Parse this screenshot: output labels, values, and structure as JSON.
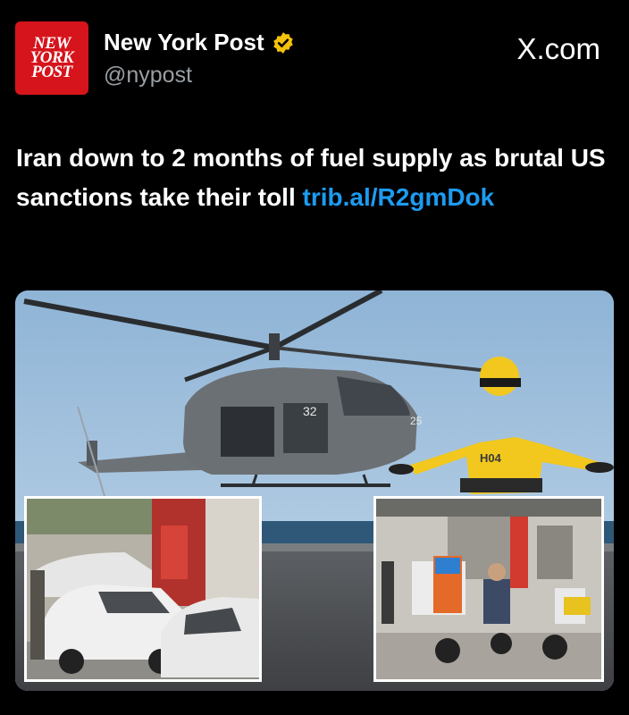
{
  "account": {
    "logo_lines": [
      "NEW",
      "YORK",
      "POST"
    ],
    "display_name": "New York Post",
    "handle": "@nypost",
    "verified_color": "#f4c20d",
    "brand_color": "#d6141c"
  },
  "source_label": "X.com",
  "post": {
    "text": "Iran down to 2 months of fuel supply as brutal US sanctions take their toll ",
    "link": "trib.al/R2gmDok",
    "link_color": "#1d9bf0"
  },
  "photo": {
    "helicopter_numbers": [
      "32",
      "25"
    ],
    "vest_text": "H04"
  }
}
